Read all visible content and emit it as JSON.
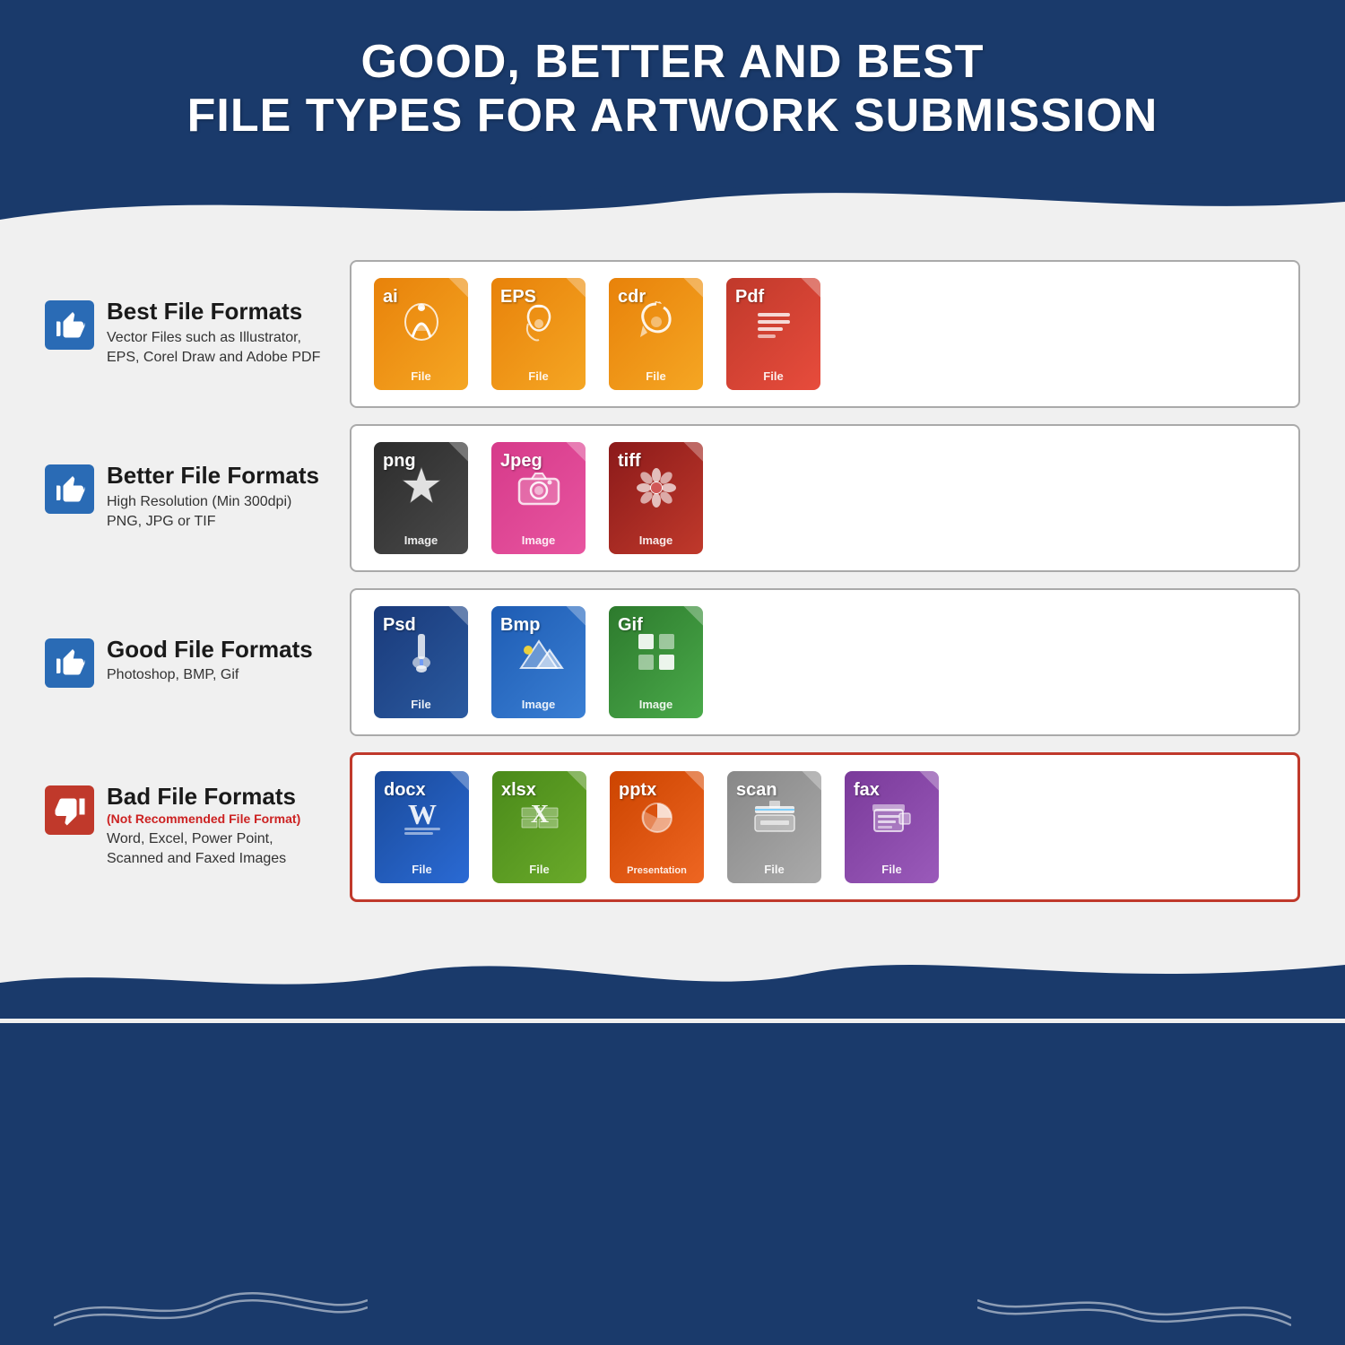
{
  "header": {
    "line1": "GOOD, BETTER AND BEST",
    "line2": "FILE TYPES FOR ARTWORK SUBMISSION"
  },
  "rows": [
    {
      "id": "best",
      "icon_type": "thumbs-up",
      "title": "Best File Formats",
      "subtitle": "",
      "description": "Vector Files such as Illustrator,\nEPS, Corel Draw and Adobe PDF",
      "border": "normal",
      "files": [
        {
          "ext": "ai",
          "color": "orange",
          "label": "File",
          "icon": "pen"
        },
        {
          "ext": "EPS",
          "color": "orange",
          "label": "File",
          "icon": "pen"
        },
        {
          "ext": "cdr",
          "color": "orange",
          "label": "File",
          "icon": "pen"
        },
        {
          "ext": "Pdf",
          "color": "red",
          "label": "File",
          "icon": "pdf-lines"
        }
      ]
    },
    {
      "id": "better",
      "icon_type": "thumbs-up",
      "title": "Better File Formats",
      "subtitle": "",
      "description": "High Resolution (Min 300dpi)\nPNG, JPG or TIF",
      "border": "normal",
      "files": [
        {
          "ext": "png",
          "color": "dark-gray",
          "label": "Image",
          "icon": "star"
        },
        {
          "ext": "Jpeg",
          "color": "pink",
          "label": "Image",
          "icon": "camera"
        },
        {
          "ext": "tiff",
          "color": "dark-red",
          "label": "Image",
          "icon": "flower"
        }
      ]
    },
    {
      "id": "good",
      "icon_type": "thumbs-up",
      "title": "Good File Formats",
      "subtitle": "",
      "description": "Photoshop, BMP, Gif",
      "border": "normal",
      "files": [
        {
          "ext": "Psd",
          "color": "dark-blue",
          "label": "File",
          "icon": "brush"
        },
        {
          "ext": "Bmp",
          "color": "blue",
          "label": "Image",
          "icon": "mountain"
        },
        {
          "ext": "Gif",
          "color": "green",
          "label": "Image",
          "icon": "grid"
        }
      ]
    },
    {
      "id": "bad",
      "icon_type": "thumbs-down",
      "title": "Bad File Formats",
      "subtitle": "(Not Recommended File Format)",
      "description": "Word, Excel, Power Point,\nScanned and Faxed Images",
      "border": "bad",
      "files": [
        {
          "ext": "docx",
          "color": "doc-blue",
          "label": "File",
          "icon": "word"
        },
        {
          "ext": "xlsx",
          "color": "xls-green",
          "label": "File",
          "icon": "excel"
        },
        {
          "ext": "pptx",
          "color": "ppt-orange",
          "label": "Presentation",
          "icon": "ppt"
        },
        {
          "ext": "scan",
          "color": "scan-gray",
          "label": "File",
          "icon": "scanner"
        },
        {
          "ext": "fax",
          "color": "fax-purple",
          "label": "File",
          "icon": "fax"
        }
      ]
    }
  ],
  "colors": {
    "background": "#1a3a6b",
    "accent_blue": "#2a6bb5",
    "accent_red": "#c0392b",
    "white": "#ffffff"
  }
}
